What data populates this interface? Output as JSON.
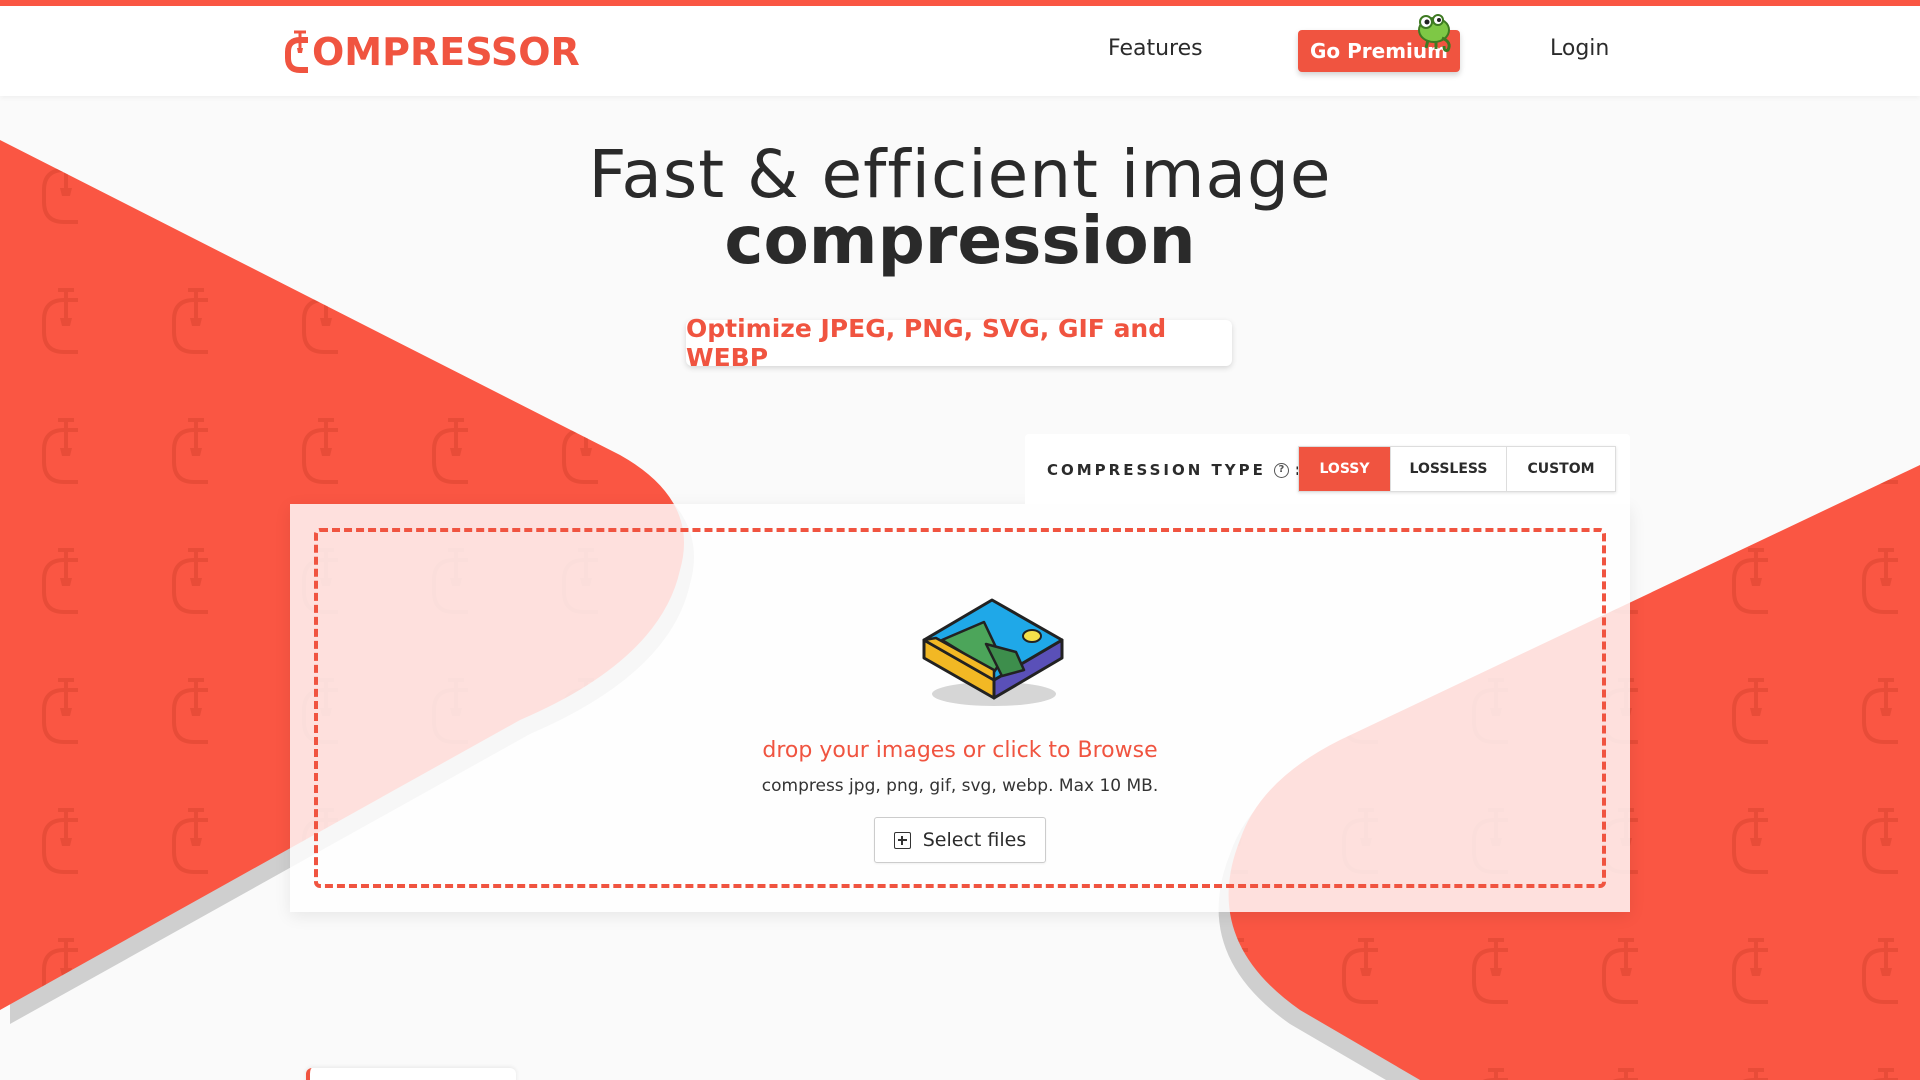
{
  "brand": {
    "logo_text": "OMPRESSOR",
    "accent_color": "#f05440"
  },
  "nav": {
    "features": "Features",
    "premium": "Go Premium",
    "login": "Login",
    "mascot_icon": "chameleon-icon"
  },
  "hero": {
    "line1": "Fast & efficient image",
    "line2": "compression",
    "subtitle": "Optimize JPEG, PNG, SVG, GIF and WEBP"
  },
  "compression": {
    "label": "COMPRESSION TYPE",
    "help_icon": "?",
    "colon": ":",
    "options": [
      "LOSSY",
      "LOSSLESS",
      "CUSTOM"
    ],
    "selected": "LOSSY"
  },
  "dropzone": {
    "title": "drop your images or click to Browse",
    "subtitle": "compress jpg, png, gif, svg, webp. Max 10 MB.",
    "button": "Select files",
    "icon": "image-isometric-icon"
  }
}
